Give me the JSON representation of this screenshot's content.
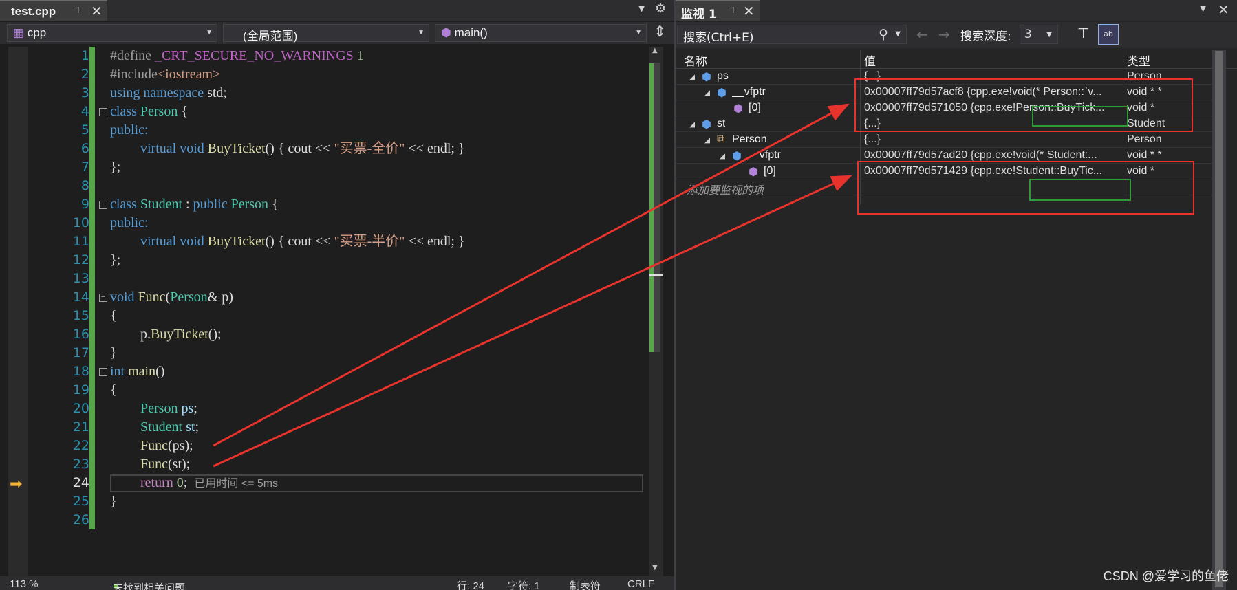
{
  "editor": {
    "tab_title": "test.cpp",
    "nav": {
      "project": "cpp",
      "scope": "(全局范围)",
      "member": "main()"
    },
    "lines": [
      "1",
      "2",
      "3",
      "4",
      "5",
      "6",
      "7",
      "8",
      "9",
      "10",
      "11",
      "12",
      "13",
      "14",
      "15",
      "16",
      "17",
      "18",
      "19",
      "20",
      "21",
      "22",
      "23",
      "24",
      "25",
      "26"
    ],
    "code": {
      "l1_a": "#define ",
      "l1_b": "_CRT_SECURE_NO_WARNINGS",
      "l1_c": " 1",
      "l2_a": "#include",
      "l2_b": "<iostream>",
      "l3_a": "using",
      "l3_b": " namespace ",
      "l3_c": "std",
      "l3_d": ";",
      "l4_a": "class",
      "l4_b": " Person",
      "l4_c": " {",
      "l5": "public:",
      "l6_a": "virtual",
      "l6_b": " void ",
      "l6_c": "BuyTicket",
      "l6_d": "() { cout << ",
      "l6_e": "\"买票-全价\"",
      "l6_f": " << endl; }",
      "l7": "};",
      "l9_a": "class",
      "l9_b": " Student",
      "l9_c": " : ",
      "l9_d": "public",
      "l9_e": " Person",
      "l9_f": " {",
      "l10": "public:",
      "l11_a": "virtual",
      "l11_b": " void ",
      "l11_c": "BuyTicket",
      "l11_d": "() { cout << ",
      "l11_e": "\"买票-半价\"",
      "l11_f": " << endl; }",
      "l12": "};",
      "l14_a": "void",
      "l14_b": " Func",
      "l14_c": "(",
      "l14_d": "Person",
      "l14_e": "& p)",
      "l15": "{",
      "l16_a": "p.",
      "l16_b": "BuyTicket",
      "l16_c": "();",
      "l17": "}",
      "l18_a": "int",
      "l18_b": " main",
      "l18_c": "()",
      "l19": "{",
      "l20_a": "Person",
      "l20_b": " ps",
      "l20_c": ";",
      "l21_a": "Student",
      "l21_b": " st",
      "l21_c": ";",
      "l22_a": "Func",
      "l22_b": "(ps);",
      "l23_a": "Func",
      "l23_b": "(st);",
      "l24_a": "return",
      "l24_b": " 0",
      "l24_c": ";",
      "l24_hint": "已用时间 <= 5ms",
      "l25": "}"
    },
    "status": {
      "zoom": "113 %",
      "issues": "未找到相关问题",
      "line": "行: 24",
      "col": "字符: 1",
      "tabs": "制表符",
      "eol": "CRLF"
    }
  },
  "watch": {
    "tab_title": "监视 1",
    "search_placeholder": "搜索(Ctrl+E)",
    "depth_label": "搜索深度:",
    "depth_value": "3",
    "headers": {
      "name": "名称",
      "value": "值",
      "type": "类型"
    },
    "rows": [
      {
        "name": "ps",
        "value": "{...}",
        "type": "Person"
      },
      {
        "name": "__vfptr",
        "value": "0x00007ff79d57acf8 {cpp.exe!void(* Person::`v...",
        "type": "void * *"
      },
      {
        "name": "[0]",
        "value": "0x00007ff79d571050 {cpp.exe!Person::BuyTick...",
        "type": "void *"
      },
      {
        "name": "st",
        "value": "{...}",
        "type": "Student"
      },
      {
        "name": "Person",
        "value": "{...}",
        "type": "Person"
      },
      {
        "name": "__vfptr",
        "value": "0x00007ff79d57ad20 {cpp.exe!void(* Student:...",
        "type": "void * *"
      },
      {
        "name": "[0]",
        "value": "0x00007ff79d571429 {cpp.exe!Student::BuyTic...",
        "type": "void *"
      }
    ],
    "add_hint": "添加要监视的项"
  },
  "watermark": "CSDN @爱学习的鱼佬",
  "colors": {
    "annotation_red": "#e8332d",
    "annotation_green": "#2f9a3a",
    "change_bar": "#57a64a"
  }
}
